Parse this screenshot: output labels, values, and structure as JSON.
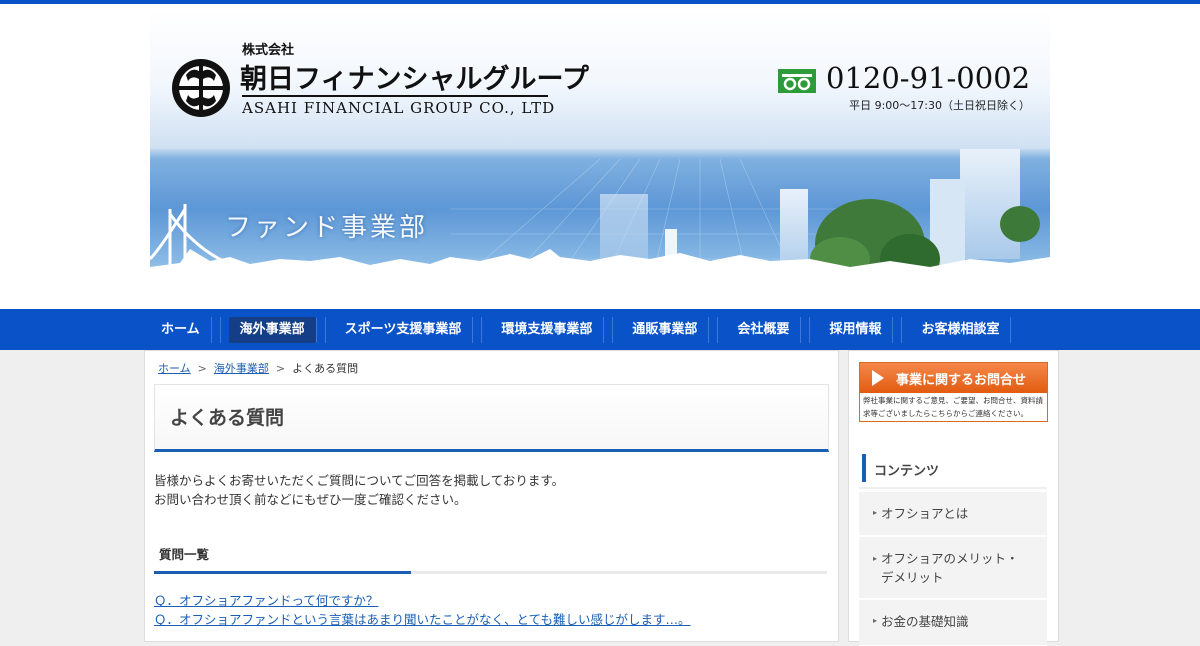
{
  "header": {
    "company_prefix": "株式会社",
    "company_name_jp": "朝日フィナンシャルグループ",
    "company_name_en": "ASAHI FINANCIAL GROUP CO., LTD",
    "phone": "0120-91-0002",
    "hours": "平日 9:00〜17:30（土日祝日除く）",
    "department": "ファンド事業部"
  },
  "nav": {
    "items": [
      {
        "label": "ホーム"
      },
      {
        "label": "海外事業部"
      },
      {
        "label": "スポーツ支援事業部"
      },
      {
        "label": "環境支援事業部"
      },
      {
        "label": "通販事業部"
      },
      {
        "label": "会社概要"
      },
      {
        "label": "採用情報"
      },
      {
        "label": "お客様相談室"
      }
    ],
    "active_index": 1
  },
  "breadcrumb": {
    "home": "ホーム",
    "section": "海外事業部",
    "current": "よくある質問",
    "separator": ">"
  },
  "main": {
    "title": "よくある質問",
    "intro_line1": "皆様からよくお寄せいただくご質問についてご回答を掲載しております。",
    "intro_line2": "お問い合わせ頂く前などにもぜひ一度ご確認ください。",
    "list_heading": "質問一覧",
    "questions": [
      "Ｑ．オフショアファンドって何ですか？",
      "Ｑ．オフショアファンドという言葉はあまり聞いたことがなく、とても難しい感じがします…。"
    ]
  },
  "sidebar": {
    "contact_label": "事業に関するお問合せ",
    "contact_note": "弊社事業に関するご意見、ご要望、お問合せ、資料請求等ございましたらこちらからご連絡ください。",
    "contents_heading": "コンテンツ",
    "items": [
      {
        "label": "オフショアとは"
      },
      {
        "label_line1": "オフショアのメリット・",
        "label_line2": "デメリット"
      },
      {
        "label": "お金の基礎知識"
      }
    ]
  },
  "colors": {
    "brand_blue": "#0a52c8",
    "link_blue": "#1a5fb4",
    "contact_orange": "#e25b10",
    "freedial_green": "#2e9b3a"
  }
}
